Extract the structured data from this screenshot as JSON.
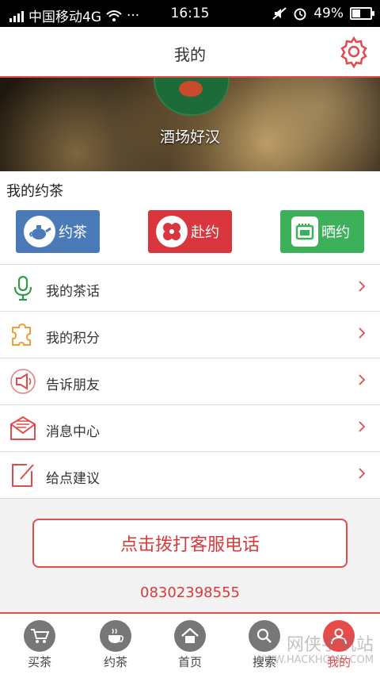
{
  "status_bar": {
    "carrier": "中国移动4G",
    "dots": "···",
    "time": "16:15",
    "battery": "49%",
    "battery_level": 0.49
  },
  "header": {
    "title": "我的"
  },
  "profile": {
    "username": "酒场好汉"
  },
  "section": {
    "title": "我的约茶"
  },
  "actions": [
    {
      "label": "约茶",
      "icon": "teapot-icon",
      "color": "#4b7ab9"
    },
    {
      "label": "赴约",
      "icon": "puzzle-flower-icon",
      "color": "#d9373d"
    },
    {
      "label": "晒约",
      "icon": "photo-frame-icon",
      "color": "#3db05a"
    }
  ],
  "menu": [
    {
      "label": "我的茶话",
      "icon": "microphone-icon"
    },
    {
      "label": "我的积分",
      "icon": "puzzle-icon"
    },
    {
      "label": "告诉朋友",
      "icon": "megaphone-icon"
    },
    {
      "label": "消息中心",
      "icon": "envelope-icon"
    },
    {
      "label": "给点建议",
      "icon": "edit-icon"
    }
  ],
  "call": {
    "button_label": "点击拨打客服电话",
    "phone": "08302398555"
  },
  "tabs": [
    {
      "label": "买茶",
      "icon": "cart-icon"
    },
    {
      "label": "约茶",
      "icon": "tea-cup-icon"
    },
    {
      "label": "首页",
      "icon": "home-icon"
    },
    {
      "label": "搜索",
      "icon": "search-icon"
    },
    {
      "label": "我的",
      "icon": "user-icon",
      "active": true
    }
  ],
  "watermark": {
    "line1": "网侠手机站",
    "line2": "WWW.HACKHOME.COM"
  },
  "colors": {
    "accent": "#e14b4b",
    "text": "#333333"
  }
}
